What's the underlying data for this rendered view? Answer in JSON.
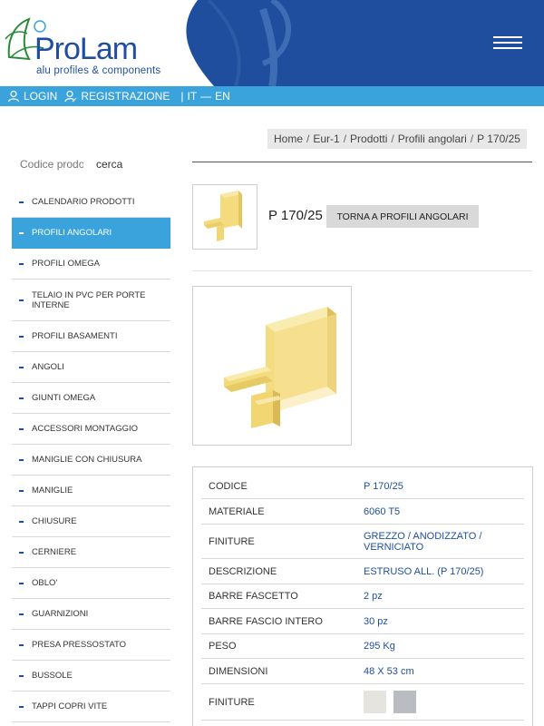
{
  "header": {
    "logo_text": "ProLam",
    "logo_subtitle": "alu profiles & components",
    "menu_icon": "hamburger-icon"
  },
  "topbar": {
    "login": "LOGIN",
    "register": "REGISTRAZIONE",
    "lang_it": "IT",
    "lang_sep": "—",
    "lang_en": "EN"
  },
  "breadcrumb": [
    "Home",
    "Eur-1",
    "Prodotti",
    "Profili angolari",
    "P 170/25"
  ],
  "search": {
    "placeholder": "Codice prodotto",
    "button": "cerca"
  },
  "sidebar": {
    "items": [
      {
        "label": "CALENDARIO PRODOTTI",
        "active": false
      },
      {
        "label": "PROFILI ANGOLARI",
        "active": true
      },
      {
        "label": "PROFILI OMEGA",
        "active": false
      },
      {
        "label": "TELAIO IN PVC PER PORTE INTERNE",
        "active": false
      },
      {
        "label": "PROFILI BASAMENTI",
        "active": false
      },
      {
        "label": "ANGOLI",
        "active": false
      },
      {
        "label": "GIUNTI OMEGA",
        "active": false
      },
      {
        "label": "ACCESSORI MONTAGGIO",
        "active": false
      },
      {
        "label": "MANIGLIE CON CHIUSURA",
        "active": false
      },
      {
        "label": "MANIGLIE",
        "active": false
      },
      {
        "label": "CHIUSURE",
        "active": false
      },
      {
        "label": "CERNIERE",
        "active": false
      },
      {
        "label": "OBLO'",
        "active": false
      },
      {
        "label": "GUARNIZIONI",
        "active": false
      },
      {
        "label": "PRESA PRESSOSTATO",
        "active": false
      },
      {
        "label": "BUSSOLE",
        "active": false
      },
      {
        "label": "TAPPI COPRI VITE",
        "active": false
      }
    ]
  },
  "product": {
    "title": "P 170/25",
    "back_label": "TORNA A PROFILI ANGOLARI"
  },
  "specs": [
    {
      "key": "CODICE",
      "value": "P 170/25"
    },
    {
      "key": "MATERIALE",
      "value": "6060 T5"
    },
    {
      "key": "FINITURE",
      "value": "GREZZO / ANODIZZATO / VERNICIATO"
    },
    {
      "key": "DESCRIZIONE",
      "value": "ESTRUSO ALL. (P 170/25)"
    },
    {
      "key": "BARRE FASCETTO",
      "value": "2 pz"
    },
    {
      "key": "BARRE FASCIO INTERO",
      "value": "30 pz"
    },
    {
      "key": "PESO",
      "value": "295 Kg"
    },
    {
      "key": "DIMENSIONI",
      "value": "48 X 53 cm"
    },
    {
      "key": "FINITURE",
      "value": ""
    }
  ],
  "colors": {
    "brand_blue": "#1f4e9e",
    "accent_blue": "#3aa3dc",
    "profile_yellow": "#f5e08a",
    "swatch_raw": "#e6e4de",
    "swatch_silver": "#b9bcc0"
  }
}
